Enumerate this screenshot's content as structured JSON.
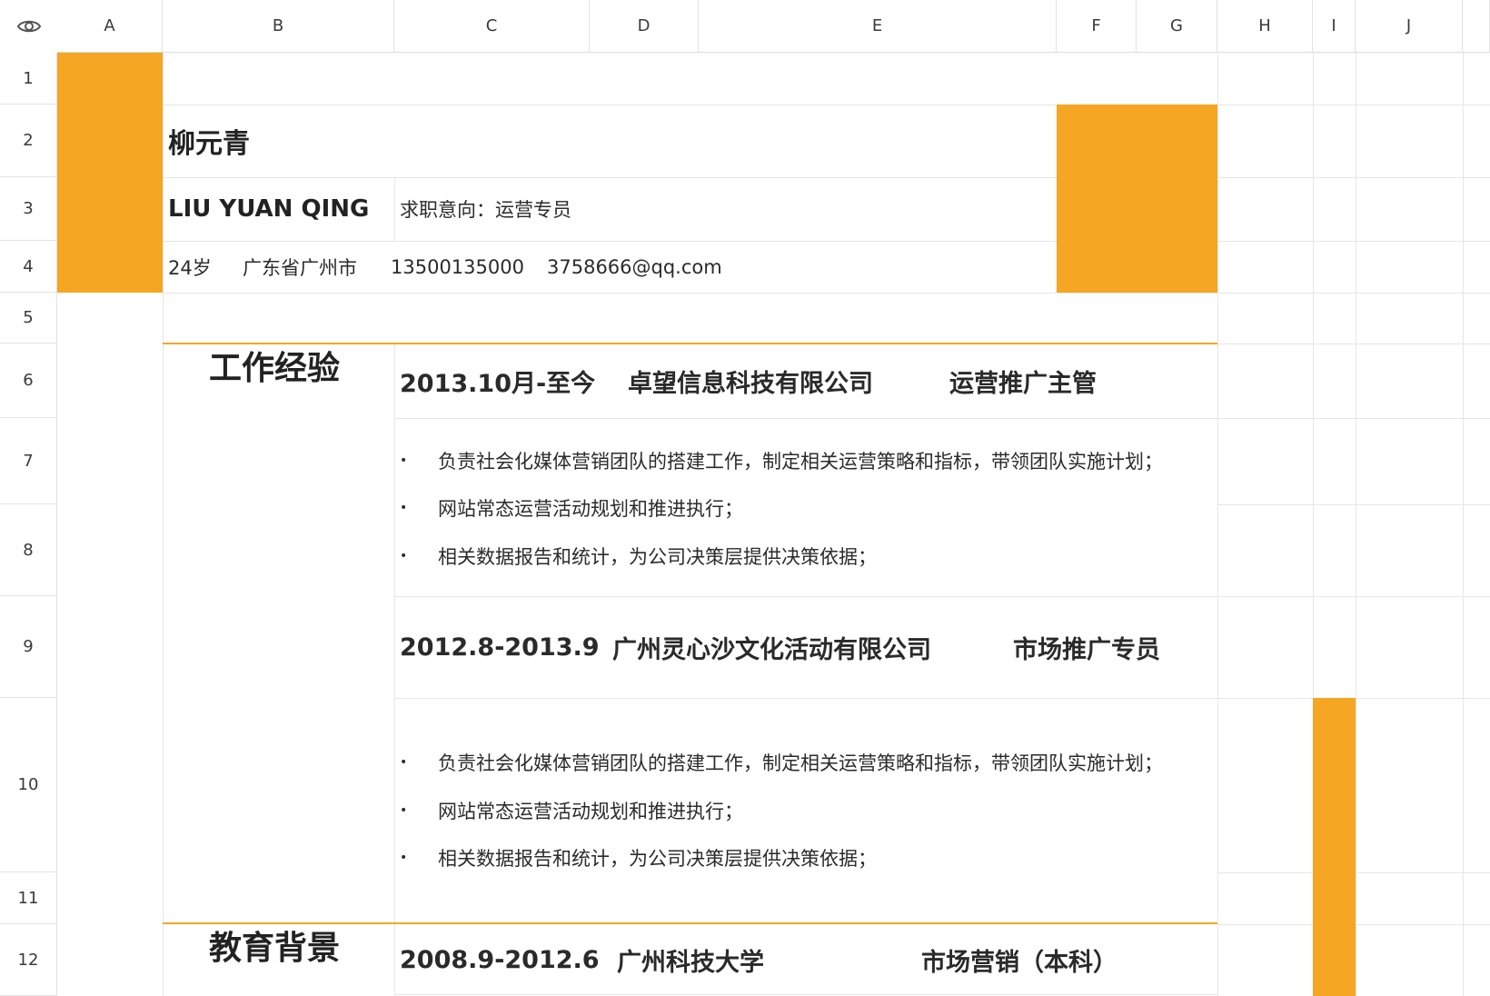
{
  "columns": [
    "A",
    "B",
    "C",
    "D",
    "E",
    "F",
    "G",
    "H",
    "I",
    "J"
  ],
  "rows": [
    "1",
    "2",
    "3",
    "4",
    "5",
    "6",
    "7",
    "8",
    "9",
    "10",
    "11",
    "12"
  ],
  "resume": {
    "name": "柳元青",
    "pinyin": "LIU YUAN QING",
    "objective": "求职意向：运营专员",
    "age": "24岁",
    "location": "广东省广州市",
    "phone": "13500135000",
    "email": "3758666@qq.com",
    "sections": {
      "work": "工作经验",
      "education": "教育背景"
    },
    "jobs": [
      {
        "period": "2013.10月-至今",
        "company": "卓望信息科技有限公司",
        "title": "运营推广主管",
        "duties": [
          "负责社会化媒体营销团队的搭建工作，制定相关运营策略和指标，带领团队实施计划；",
          "网站常态运营活动规划和推进执行；",
          "相关数据报告和统计，为公司决策层提供决策依据；"
        ]
      },
      {
        "period": "2012.8-2013.9",
        "company": "广州灵心沙文化活动有限公司",
        "title": "市场推广专员",
        "duties": [
          "负责社会化媒体营销团队的搭建工作，制定相关运营策略和指标，带领团队实施计划；",
          "网站常态运营活动规划和推进执行；",
          "相关数据报告和统计，为公司决策层提供决策依据；"
        ]
      }
    ],
    "education": {
      "period": "2008.9-2012.6",
      "school": "广州科技大学",
      "major": "市场营销（本科）"
    }
  },
  "colors": {
    "accent": "#f5a623",
    "grid": "#e6e6e6",
    "text": "#2b2b2b"
  }
}
